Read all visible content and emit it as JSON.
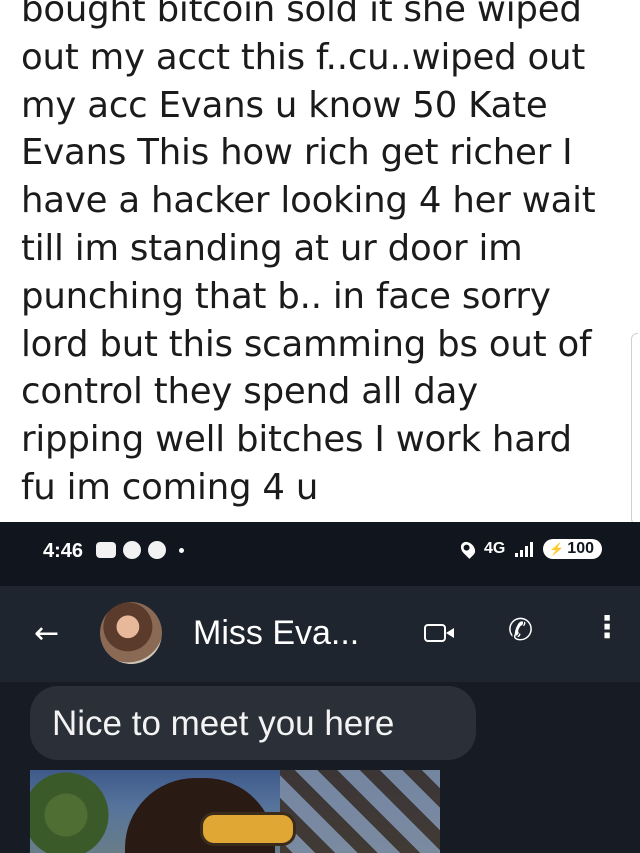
{
  "post": {
    "lines": [
      "bought bitcoin sold it she wiped",
      "out my acct  this f..cu..wiped out",
      "my acc Evans u know 50 Kate",
      "Evans This how rich get richer I",
      "have a hacker looking 4 her wait",
      "till im standing at ur door im",
      "punching that b.. in face sorry",
      "lord but this scamming bs out of",
      "control they spend all day",
      "ripping well bitches I work hard",
      "fu im coming 4 u"
    ]
  },
  "status_bar": {
    "time": "4:46",
    "network": "4G",
    "battery": "100"
  },
  "chat_header": {
    "contact_name": "Miss Eva..."
  },
  "messages": [
    {
      "text": "Nice to meet you here"
    }
  ],
  "colors": {
    "statusbar_bg": "#11151d",
    "appbar_bg": "#1f252f",
    "chat_bg": "#161b24",
    "bubble_bg": "#2b3038"
  }
}
